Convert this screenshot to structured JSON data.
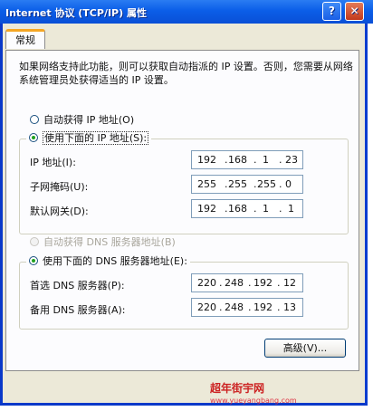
{
  "window": {
    "title": "Internet 协议 (TCP/IP) 属性",
    "help_glyph": "?",
    "close_glyph": "✕"
  },
  "tabs": [
    {
      "label": "常规",
      "active": true
    }
  ],
  "intro": "如果网络支持此功能，则可以获取自动指派的 IP 设置。否则，您需要从网络系统管理员处获得适当的 IP 设置。",
  "ip_section": {
    "auto_label": "自动获得 IP 地址(O)",
    "manual_label": "使用下面的 IP 地址(S):",
    "selected": "manual",
    "fields": [
      {
        "label": "IP 地址(I):",
        "octets": [
          "192",
          "168",
          "1",
          "23"
        ]
      },
      {
        "label": "子网掩码(U):",
        "octets": [
          "255",
          "255",
          "255",
          "0"
        ]
      },
      {
        "label": "默认网关(D):",
        "octets": [
          "192",
          "168",
          "1",
          "1"
        ]
      }
    ]
  },
  "dns_section": {
    "auto_label": "自动获得 DNS 服务器地址(B)",
    "manual_label": "使用下面的 DNS 服务器地址(E):",
    "selected": "manual",
    "auto_enabled": false,
    "fields": [
      {
        "label": "首选 DNS 服务器(P):",
        "octets": [
          "220",
          "248",
          "192",
          "12"
        ]
      },
      {
        "label": "备用 DNS 服务器(A):",
        "octets": [
          "220",
          "248",
          "192",
          "13"
        ]
      }
    ]
  },
  "advanced_button": "高级(V)...",
  "watermark": {
    "text": "超年街宇网",
    "url": "www.yueyangbang.com"
  },
  "colors": {
    "titlebar": "#0b5ee8",
    "tab_highlight": "#f5a623",
    "radio_selected": "#21a121"
  }
}
